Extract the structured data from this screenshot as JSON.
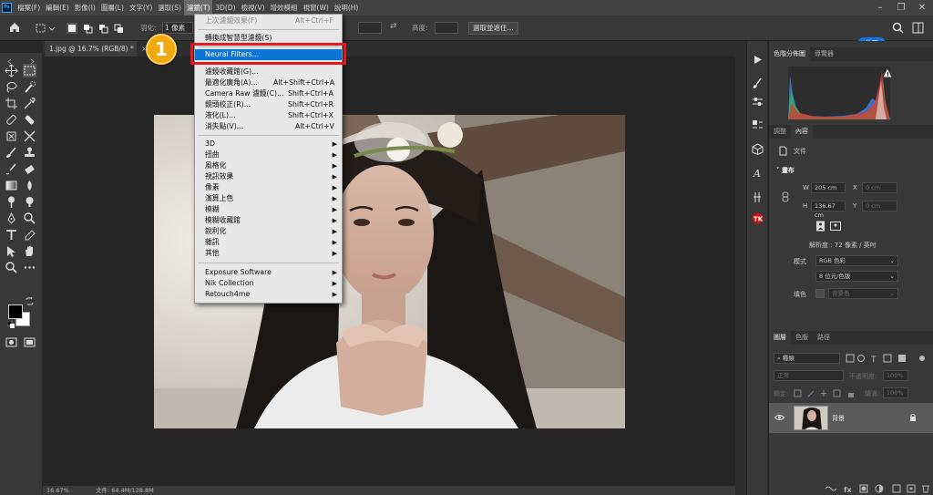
{
  "menubar": {
    "logo": "Ps",
    "items": [
      {
        "label": "檔案(F)"
      },
      {
        "label": "編輯(E)"
      },
      {
        "label": "影像(I)"
      },
      {
        "label": "圖層(L)"
      },
      {
        "label": "文字(Y)"
      },
      {
        "label": "選取(S)"
      },
      {
        "label": "濾鏡(T)",
        "active": true
      },
      {
        "label": "3D(D)"
      },
      {
        "label": "檢視(V)"
      },
      {
        "label": "增效模組"
      },
      {
        "label": "視窗(W)"
      },
      {
        "label": "說明(H)"
      }
    ]
  },
  "optionsbar": {
    "feather_label": "羽化:",
    "feather_value": "1 像素",
    "height_label": "高度:",
    "select_mask_label": "選取並遮住...",
    "share_label": "共用"
  },
  "document": {
    "tab_title": "1.jpg @ 16.7% (RGB/8) *",
    "close_glyph": "×",
    "zoom": "16.67%",
    "doc_size": "文件: 64.4M/128.8M"
  },
  "filter_menu": {
    "top_items": [
      {
        "label": "上次濾鏡效果(F)",
        "shortcut": "Alt+Ctrl+F",
        "disabled": true
      },
      {
        "label": "轉換成智慧型濾鏡(S)",
        "shortcut": ""
      }
    ],
    "neural": "Neural Filters...",
    "gallery_items": [
      {
        "label": "濾鏡收藏館(G)...",
        "shortcut": ""
      },
      {
        "label": "最適化廣角(A)...",
        "shortcut": "Alt+Shift+Ctrl+A"
      },
      {
        "label": "Camera Raw 濾鏡(C)...",
        "shortcut": "Shift+Ctrl+A"
      },
      {
        "label": "鏡頭校正(R)...",
        "shortcut": "Shift+Ctrl+R"
      },
      {
        "label": "液化(L)...",
        "shortcut": "Shift+Ctrl+X"
      },
      {
        "label": "消失點(V)...",
        "shortcut": "Alt+Ctrl+V"
      }
    ],
    "sub_items": [
      "3D",
      "扭曲",
      "風格化",
      "視訊效果",
      "像素",
      "演算上色",
      "模糊",
      "模糊收藏館",
      "銳利化",
      "雜訊",
      "其他"
    ],
    "plugin_items": [
      "Exposure Software",
      "Nik Collection",
      "Retouch4me"
    ]
  },
  "callout": {
    "number": "1"
  },
  "histogram_panel": {
    "tabs": [
      "色階分佈圖",
      "導覽器"
    ],
    "warning": "!"
  },
  "properties_panel": {
    "tabs": [
      "調整",
      "內容"
    ],
    "doc_label": "文件",
    "section": "畫布",
    "w_label": "W",
    "w_value": "205 cm",
    "x_label": "X",
    "x_value": "0 cm",
    "h_label": "H",
    "h_value": "136.67 cm",
    "y_label": "Y",
    "y_value": "0 cm",
    "resolution": "解析度 : 72 像素 / 英吋",
    "mode_label": "模式",
    "mode_value": "RGB 色彩",
    "depth_value": "8 位元/色版",
    "fill_label": "填色",
    "fill_value": "背景色"
  },
  "layers_panel": {
    "tabs": [
      "圖層",
      "色版",
      "路徑"
    ],
    "filter_kind": "種類",
    "blend_mode": "正常",
    "opacity_label": "不透明度:",
    "opacity_value": "100%",
    "lock_label": "鎖定:",
    "fill_label": "填滿:",
    "fill_value": "100%",
    "layer_name": "背景"
  },
  "colors": {
    "accent": "#1473e6",
    "menu_highlight": "#0d75d6",
    "callout_red": "#e2181f",
    "callout_badge": "#f2a80f"
  }
}
